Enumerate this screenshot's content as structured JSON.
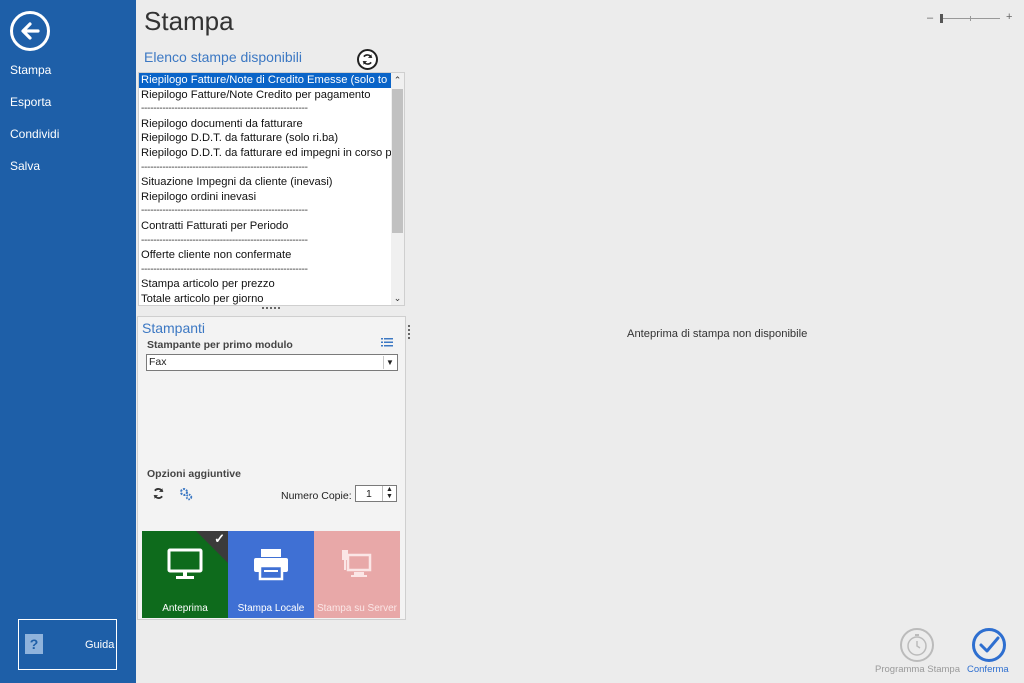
{
  "sidebar": {
    "items": [
      {
        "label": "Stampa"
      },
      {
        "label": "Esporta"
      },
      {
        "label": "Condividi"
      },
      {
        "label": "Salva"
      }
    ],
    "guida_label": "Guida",
    "guida_icon_text": "?"
  },
  "header": {
    "title": "Stampa",
    "zoom_minus": "–",
    "zoom_plus": "+"
  },
  "print_list": {
    "title": "Elenco stampe disponibili",
    "items": [
      {
        "label": "Riepilogo Fatture/Note di Credito Emesse (solo to",
        "selected": true
      },
      {
        "label": "Riepilogo Fatture/Note Credito per pagamento"
      },
      {
        "label": "-------------------------------------------------------"
      },
      {
        "label": "Riepilogo documenti da fatturare"
      },
      {
        "label": "Riepilogo D.D.T. da fatturare (solo ri.ba)"
      },
      {
        "label": "Riepilogo D.D.T. da fatturare ed impegni in corso p"
      },
      {
        "label": "-------------------------------------------------------"
      },
      {
        "label": "Situazione Impegni da cliente (inevasi)"
      },
      {
        "label": "Riepilogo ordini inevasi"
      },
      {
        "label": "-------------------------------------------------------"
      },
      {
        "label": "Contratti Fatturati per Periodo"
      },
      {
        "label": "-------------------------------------------------------"
      },
      {
        "label": "Offerte cliente non confermate"
      },
      {
        "label": "-------------------------------------------------------"
      },
      {
        "label": "Stampa articolo per prezzo"
      },
      {
        "label": "Totale articolo per giorno"
      }
    ]
  },
  "printers": {
    "title": "Stampanti",
    "printer_label": "Stampante per primo modulo",
    "selected_printer": "Fax",
    "options_label": "Opzioni aggiuntive",
    "copies_label": "Numero Copie:",
    "copies_value": "1"
  },
  "tiles": {
    "preview": "Anteprima",
    "local": "Stampa Locale",
    "server": "Stampa su Server"
  },
  "preview_message": "Anteprima di stampa non disponibile",
  "footer": {
    "schedule_label": "Programma Stampa",
    "confirm_label": "Conferma"
  },
  "colors": {
    "sidebar": "#1e5fa8",
    "accent": "#3c78c3",
    "tile_preview": "#0e6b1c",
    "tile_local": "#3f70d4",
    "tile_server": "#e8a8a8"
  }
}
